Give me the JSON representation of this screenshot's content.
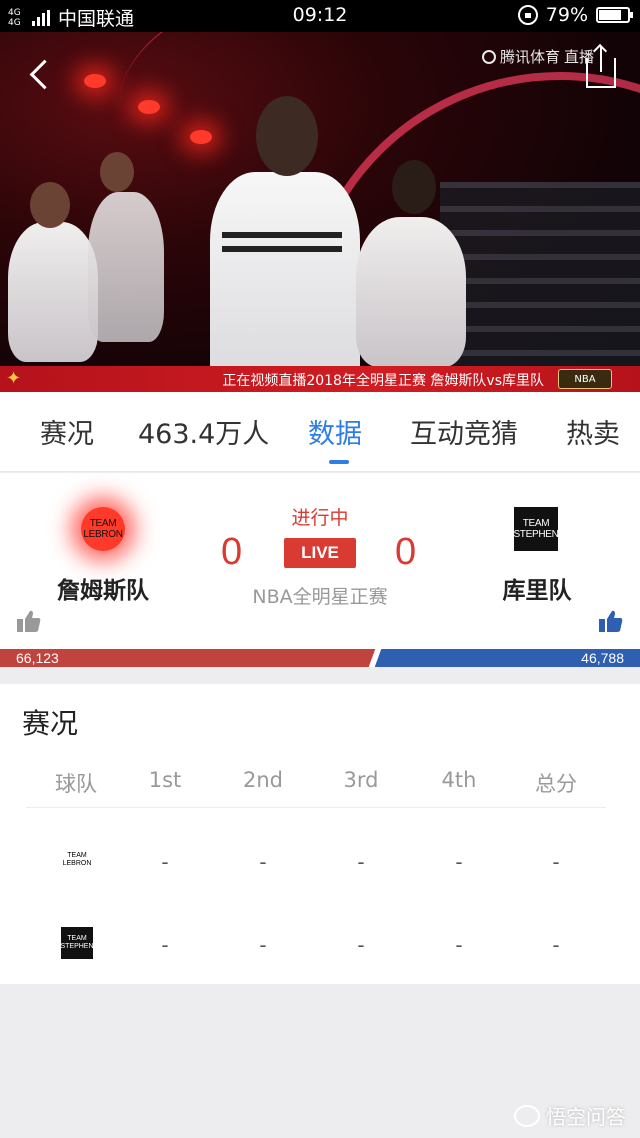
{
  "status_bar": {
    "network": "4G 4G",
    "carrier": "中国联通",
    "time": "09:12",
    "battery_percent": "79%",
    "battery_level": 0.79
  },
  "video": {
    "watermark": "腾讯体育",
    "watermark_suffix": "直播",
    "ticker_text": "正在视频直播2018年全明星正赛 詹姆斯队vs库里队",
    "ticker_logo": "NBA"
  },
  "tabs": [
    {
      "label": "赛况",
      "active": false
    },
    {
      "label": "463.4万人",
      "active": false
    },
    {
      "label": "数据",
      "active": true
    },
    {
      "label": "互动竞猜",
      "active": false
    },
    {
      "label": "热卖",
      "active": false
    }
  ],
  "match": {
    "status": "进行中",
    "live_label": "LIVE",
    "subtitle": "NBA全明星正赛",
    "home": {
      "name": "詹姆斯队",
      "logo_line1": "TEAM",
      "logo_line2": "LEBRON",
      "score": "0",
      "support": "66,123",
      "support_value": 66123
    },
    "away": {
      "name": "库里队",
      "logo_line1": "TEAM",
      "logo_line2": "STEPHEN",
      "score": "0",
      "support": "46,788",
      "support_value": 46788
    }
  },
  "quarter_table": {
    "title": "赛况",
    "headers": [
      "球队",
      "1st",
      "2nd",
      "3rd",
      "4th",
      "总分"
    ],
    "rows": [
      {
        "team_logo_line1": "TEAM",
        "team_logo_line2": "LEBRON",
        "values": [
          "-",
          "-",
          "-",
          "-",
          "-"
        ]
      },
      {
        "team_logo_line1": "TEAM",
        "team_logo_line2": "STEPHEN",
        "values": [
          "-",
          "-",
          "-",
          "-",
          "-"
        ]
      }
    ]
  },
  "footer_watermark": "悟空问答",
  "colors": {
    "accent_blue": "#2f7ee6",
    "live_red": "#d93a32",
    "home_bar": "#c0433e",
    "away_bar": "#2f5fb0"
  },
  "icons": [
    "back-icon",
    "share-icon",
    "thumbs-up-icon",
    "lock-rotation-icon",
    "battery-icon",
    "signal-icon"
  ]
}
